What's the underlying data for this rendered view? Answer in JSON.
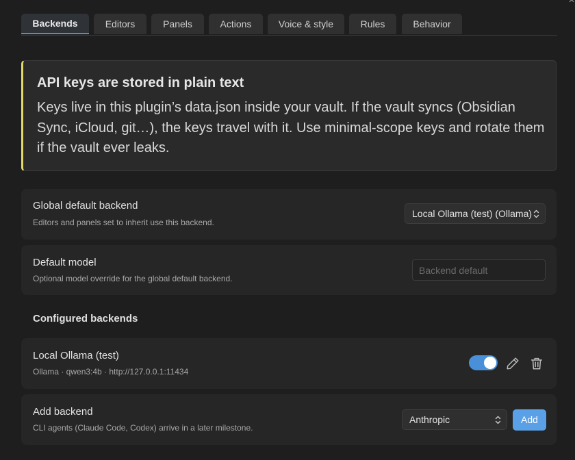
{
  "window": {
    "close_glyph": "×"
  },
  "tabs": [
    {
      "label": "Backends",
      "active": true
    },
    {
      "label": "Editors",
      "active": false
    },
    {
      "label": "Panels",
      "active": false
    },
    {
      "label": "Actions",
      "active": false
    },
    {
      "label": "Voice & style",
      "active": false
    },
    {
      "label": "Rules",
      "active": false
    },
    {
      "label": "Behavior",
      "active": false
    }
  ],
  "callout": {
    "title": "API keys are stored in plain text",
    "body": "Keys live in this plugin’s data.json inside your vault. If the vault syncs (Obsidian Sync, iCloud, git…), the keys travel with it. Use minimal-scope keys and rotate them if the vault ever leaks.",
    "accent_color": "#e3d86c"
  },
  "global_default": {
    "name": "Global default backend",
    "desc": "Editors and panels set to inherit use this backend.",
    "selected": "Local Ollama (test) (Ollama)"
  },
  "default_model": {
    "name": "Default model",
    "desc": "Optional model override for the global default backend.",
    "value": "",
    "placeholder": "Backend default"
  },
  "configured": {
    "heading": "Configured backends",
    "items": [
      {
        "name": "Local Ollama (test)",
        "desc": "Ollama · qwen3:4b · http://127.0.0.1:11434",
        "enabled": true
      }
    ]
  },
  "add_backend": {
    "name": "Add backend",
    "desc": "CLI agents (Claude Code, Codex) arrive in a later milestone.",
    "selected": "Anthropic",
    "button_label": "Add"
  },
  "icons": {
    "toggle": "toggle-on-icon",
    "edit": "pencil-icon",
    "delete": "trash-icon",
    "select": "chevron-up-down-icon"
  },
  "colors": {
    "accent": "#4a90d9",
    "button": "#5aa0e6",
    "warning": "#e3d86c"
  }
}
